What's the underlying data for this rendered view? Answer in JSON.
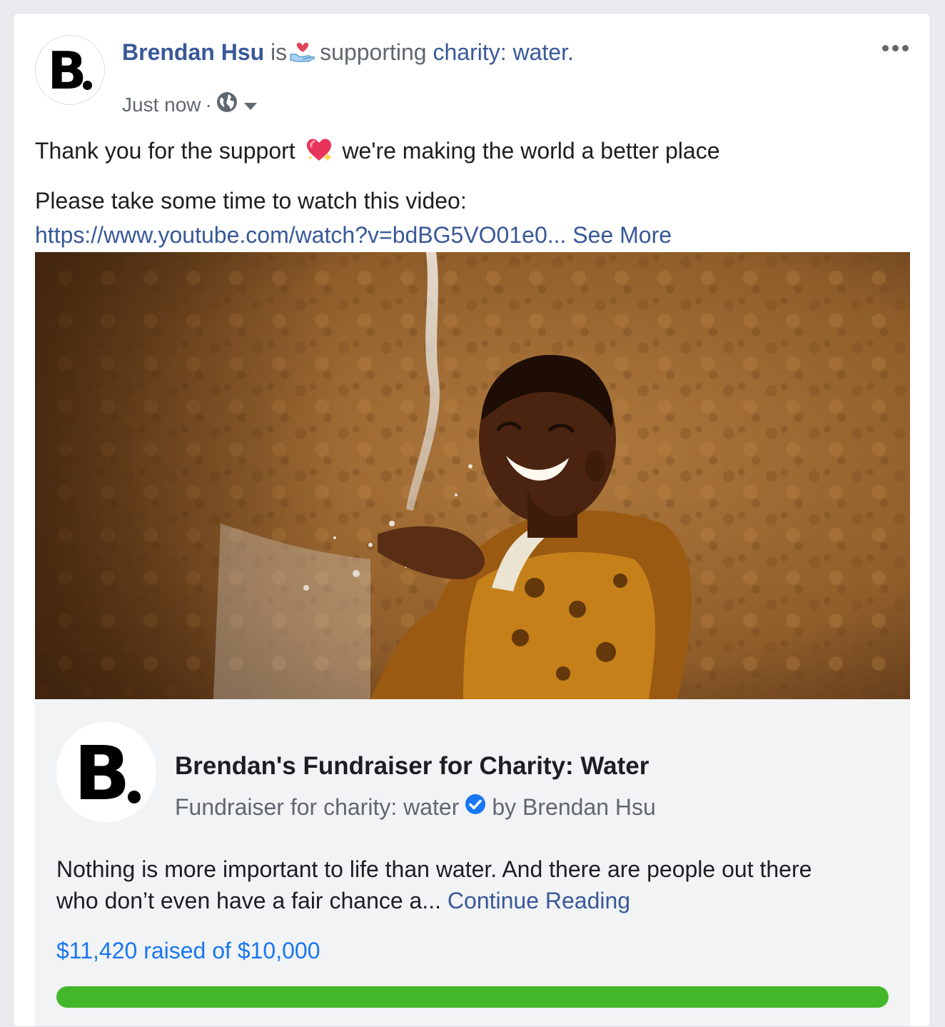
{
  "post": {
    "author": "Brendan Hsu",
    "verb_pre": "is",
    "activity": "supporting",
    "target": "charity: water.",
    "timestamp": "Just now",
    "separator": "·",
    "privacy_icon": "globe-icon",
    "text_line1_a": "Thank you for the support",
    "text_line1_b": "we're making the world a better place",
    "text_line2": "Please take some time to watch this video:",
    "link": "https://www.youtube.com/watch?v=bdBG5VO01e0...",
    "see_more": "See More"
  },
  "avatar": {
    "letter": "B"
  },
  "fundraiser": {
    "title": "Brendan's Fundraiser for Charity: Water",
    "subtitle": "Fundraiser for charity: water",
    "by": "by Brendan Hsu",
    "description": "Nothing is more important to life than water. And there are people out there who don’t even have a fair chance a...",
    "continue": "Continue Reading",
    "progress_text": "$11,420 raised of $10,000",
    "progress_fraction": 1.0
  },
  "colors": {
    "link": "#385898",
    "accent_blue": "#1877f2",
    "progress_green": "#42b72a"
  }
}
